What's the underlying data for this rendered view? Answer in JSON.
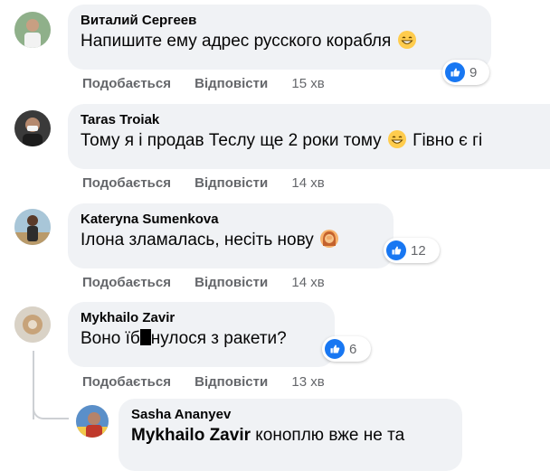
{
  "comments": [
    {
      "author": "Виталий Сергеев",
      "text": "Напишите ему адрес русского корабля",
      "emoji": "grinning-face-with-smiling-eyes",
      "reaction_count": "9",
      "like_label": "Подобається",
      "reply_label": "Відповісти",
      "time": "15 хв"
    },
    {
      "author": "Taras Troiak",
      "text_before": "Тому я і продав Теслу ще 2 роки тому",
      "emoji": "grinning-face-with-smiling-eyes",
      "text_after": "Гівно є гі",
      "like_label": "Подобається",
      "reply_label": "Відповісти",
      "time": "14 хв"
    },
    {
      "author": "Kateryna Sumenkova",
      "text": "Ілона зламалась, несіть нову",
      "emoji": "woman-facepalming",
      "reaction_count": "12",
      "like_label": "Подобається",
      "reply_label": "Відповісти",
      "time": "14 хв"
    },
    {
      "author": "Mykhailo Zavir",
      "text_before": "Воно їб",
      "text_after": "нулося з ракети?",
      "reaction_count": "6",
      "like_label": "Подобається",
      "reply_label": "Відповісти",
      "time": "13 хв"
    }
  ],
  "reply": {
    "author": "Sasha Ananyev",
    "mention": "Mykhailo Zavir",
    "text": "коноплю вже не та"
  },
  "colors": {
    "bubble": "#f0f2f5",
    "like_blue": "#1877f2",
    "secondary_text": "#65676b"
  }
}
